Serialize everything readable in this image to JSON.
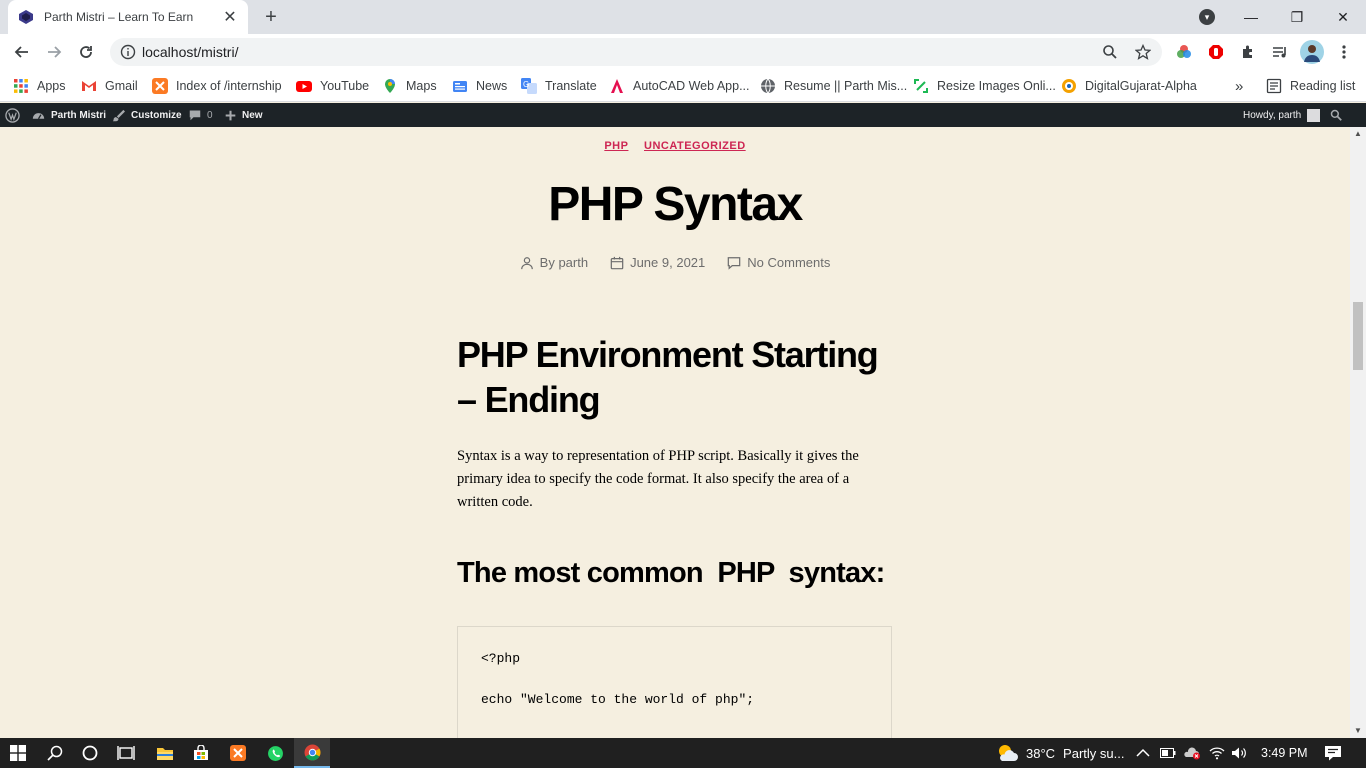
{
  "browser": {
    "tab_title": "Parth Mistri – Learn To Earn",
    "tab_close": "✕",
    "new_tab": "+",
    "url": "localhost/mistri/",
    "window_controls": {
      "minimize": "—",
      "restore": "❐",
      "close": "✕"
    },
    "profile_menu": "▾"
  },
  "bookmarks": [
    {
      "label": "Apps",
      "icon": "apps-grid-icon"
    },
    {
      "label": "Gmail",
      "icon": "gmail-icon"
    },
    {
      "label": "Index of /internship",
      "icon": "xampp-icon"
    },
    {
      "label": "YouTube",
      "icon": "youtube-icon"
    },
    {
      "label": "Maps",
      "icon": "maps-icon"
    },
    {
      "label": "News",
      "icon": "news-icon"
    },
    {
      "label": "Translate",
      "icon": "translate-icon"
    },
    {
      "label": "AutoCAD Web App...",
      "icon": "autocad-icon"
    },
    {
      "label": "Resume || Parth Mis...",
      "icon": "globe-icon"
    },
    {
      "label": "Resize Images Onli...",
      "icon": "resize-icon"
    },
    {
      "label": "DigitalGujarat-Alpha",
      "icon": "digitalgujarat-icon"
    }
  ],
  "bookmarks_overflow": "»",
  "reading_list": "Reading list",
  "wp_admin": {
    "site_name": "Parth Mistri",
    "customize": "Customize",
    "comments_count": "0",
    "new": "New",
    "howdy": "Howdy, parth"
  },
  "post": {
    "categories": [
      "PHP",
      "UNCATEGORIZED"
    ],
    "title": "PHP Syntax",
    "author": "By parth",
    "date": "June 9, 2021",
    "comments": "No Comments",
    "heading1": "PHP Environment Starting – Ending",
    "paragraph": "Syntax is a way to representation of PHP script. Basically it gives the primary idea to specify the code format. It also specify the area of a written code.",
    "heading2": "The most common  PHP  syntax:",
    "code_lines": [
      "<?php",
      "echo \"Welcome to the world of php\";"
    ]
  },
  "taskbar": {
    "weather_temp": "38°C",
    "weather_text": "Partly su...",
    "time": "3:49 PM"
  },
  "colors": {
    "accent": "#cd2653",
    "page_bg": "#f5efe0",
    "wp_bar": "#1d2327",
    "taskbar": "#202020"
  }
}
